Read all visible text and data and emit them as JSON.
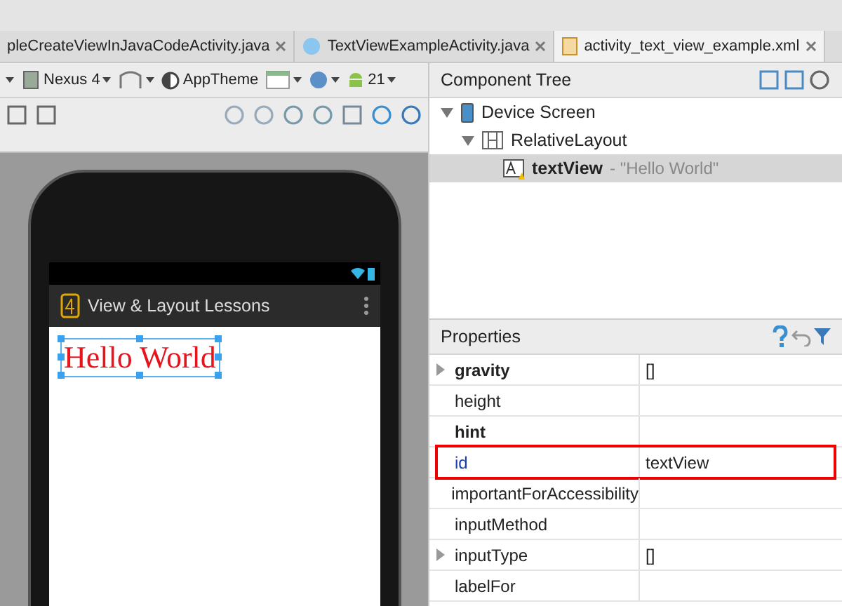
{
  "tabs": [
    {
      "label": "pleCreateViewInJavaCodeActivity.java",
      "kind": "java",
      "selected": false
    },
    {
      "label": "TextViewExampleActivity.java",
      "kind": "class",
      "selected": false
    },
    {
      "label": "activity_text_view_example.xml",
      "kind": "xml",
      "selected": true
    }
  ],
  "toolbar": {
    "device": "Nexus 4",
    "theme": "AppTheme",
    "api": "21"
  },
  "phone": {
    "app_title": "View & Layout Lessons",
    "text": "Hello World"
  },
  "component_tree": {
    "title": "Component Tree",
    "items": [
      {
        "label": "Device Screen",
        "kind": "device",
        "expanded": true,
        "selected": false,
        "children": [
          {
            "label": "RelativeLayout",
            "kind": "layout",
            "expanded": true,
            "selected": false,
            "children": [
              {
                "label": "textView",
                "detail": "- \"Hello World\"",
                "kind": "text",
                "selected": true
              }
            ]
          }
        ]
      }
    ]
  },
  "properties": {
    "title": "Properties",
    "rows": [
      {
        "name": "gravity",
        "value": "[]",
        "bold": true,
        "expandable": true,
        "highlighted": false
      },
      {
        "name": "height",
        "bold": false,
        "expandable": false,
        "highlighted": false
      },
      {
        "name": "hint",
        "bold": true,
        "expandable": false,
        "highlighted": false
      },
      {
        "name": "id",
        "value": "textView",
        "bold": false,
        "expandable": false,
        "highlighted": true
      },
      {
        "name": "importantForAccessibility",
        "bold": false,
        "expandable": false,
        "highlighted": false
      },
      {
        "name": "inputMethod",
        "bold": false,
        "expandable": false,
        "highlighted": false
      },
      {
        "name": "inputType",
        "value": "[]",
        "bold": false,
        "expandable": true,
        "highlighted": false
      },
      {
        "name": "labelFor",
        "bold": false,
        "expandable": false,
        "highlighted": false
      }
    ]
  }
}
